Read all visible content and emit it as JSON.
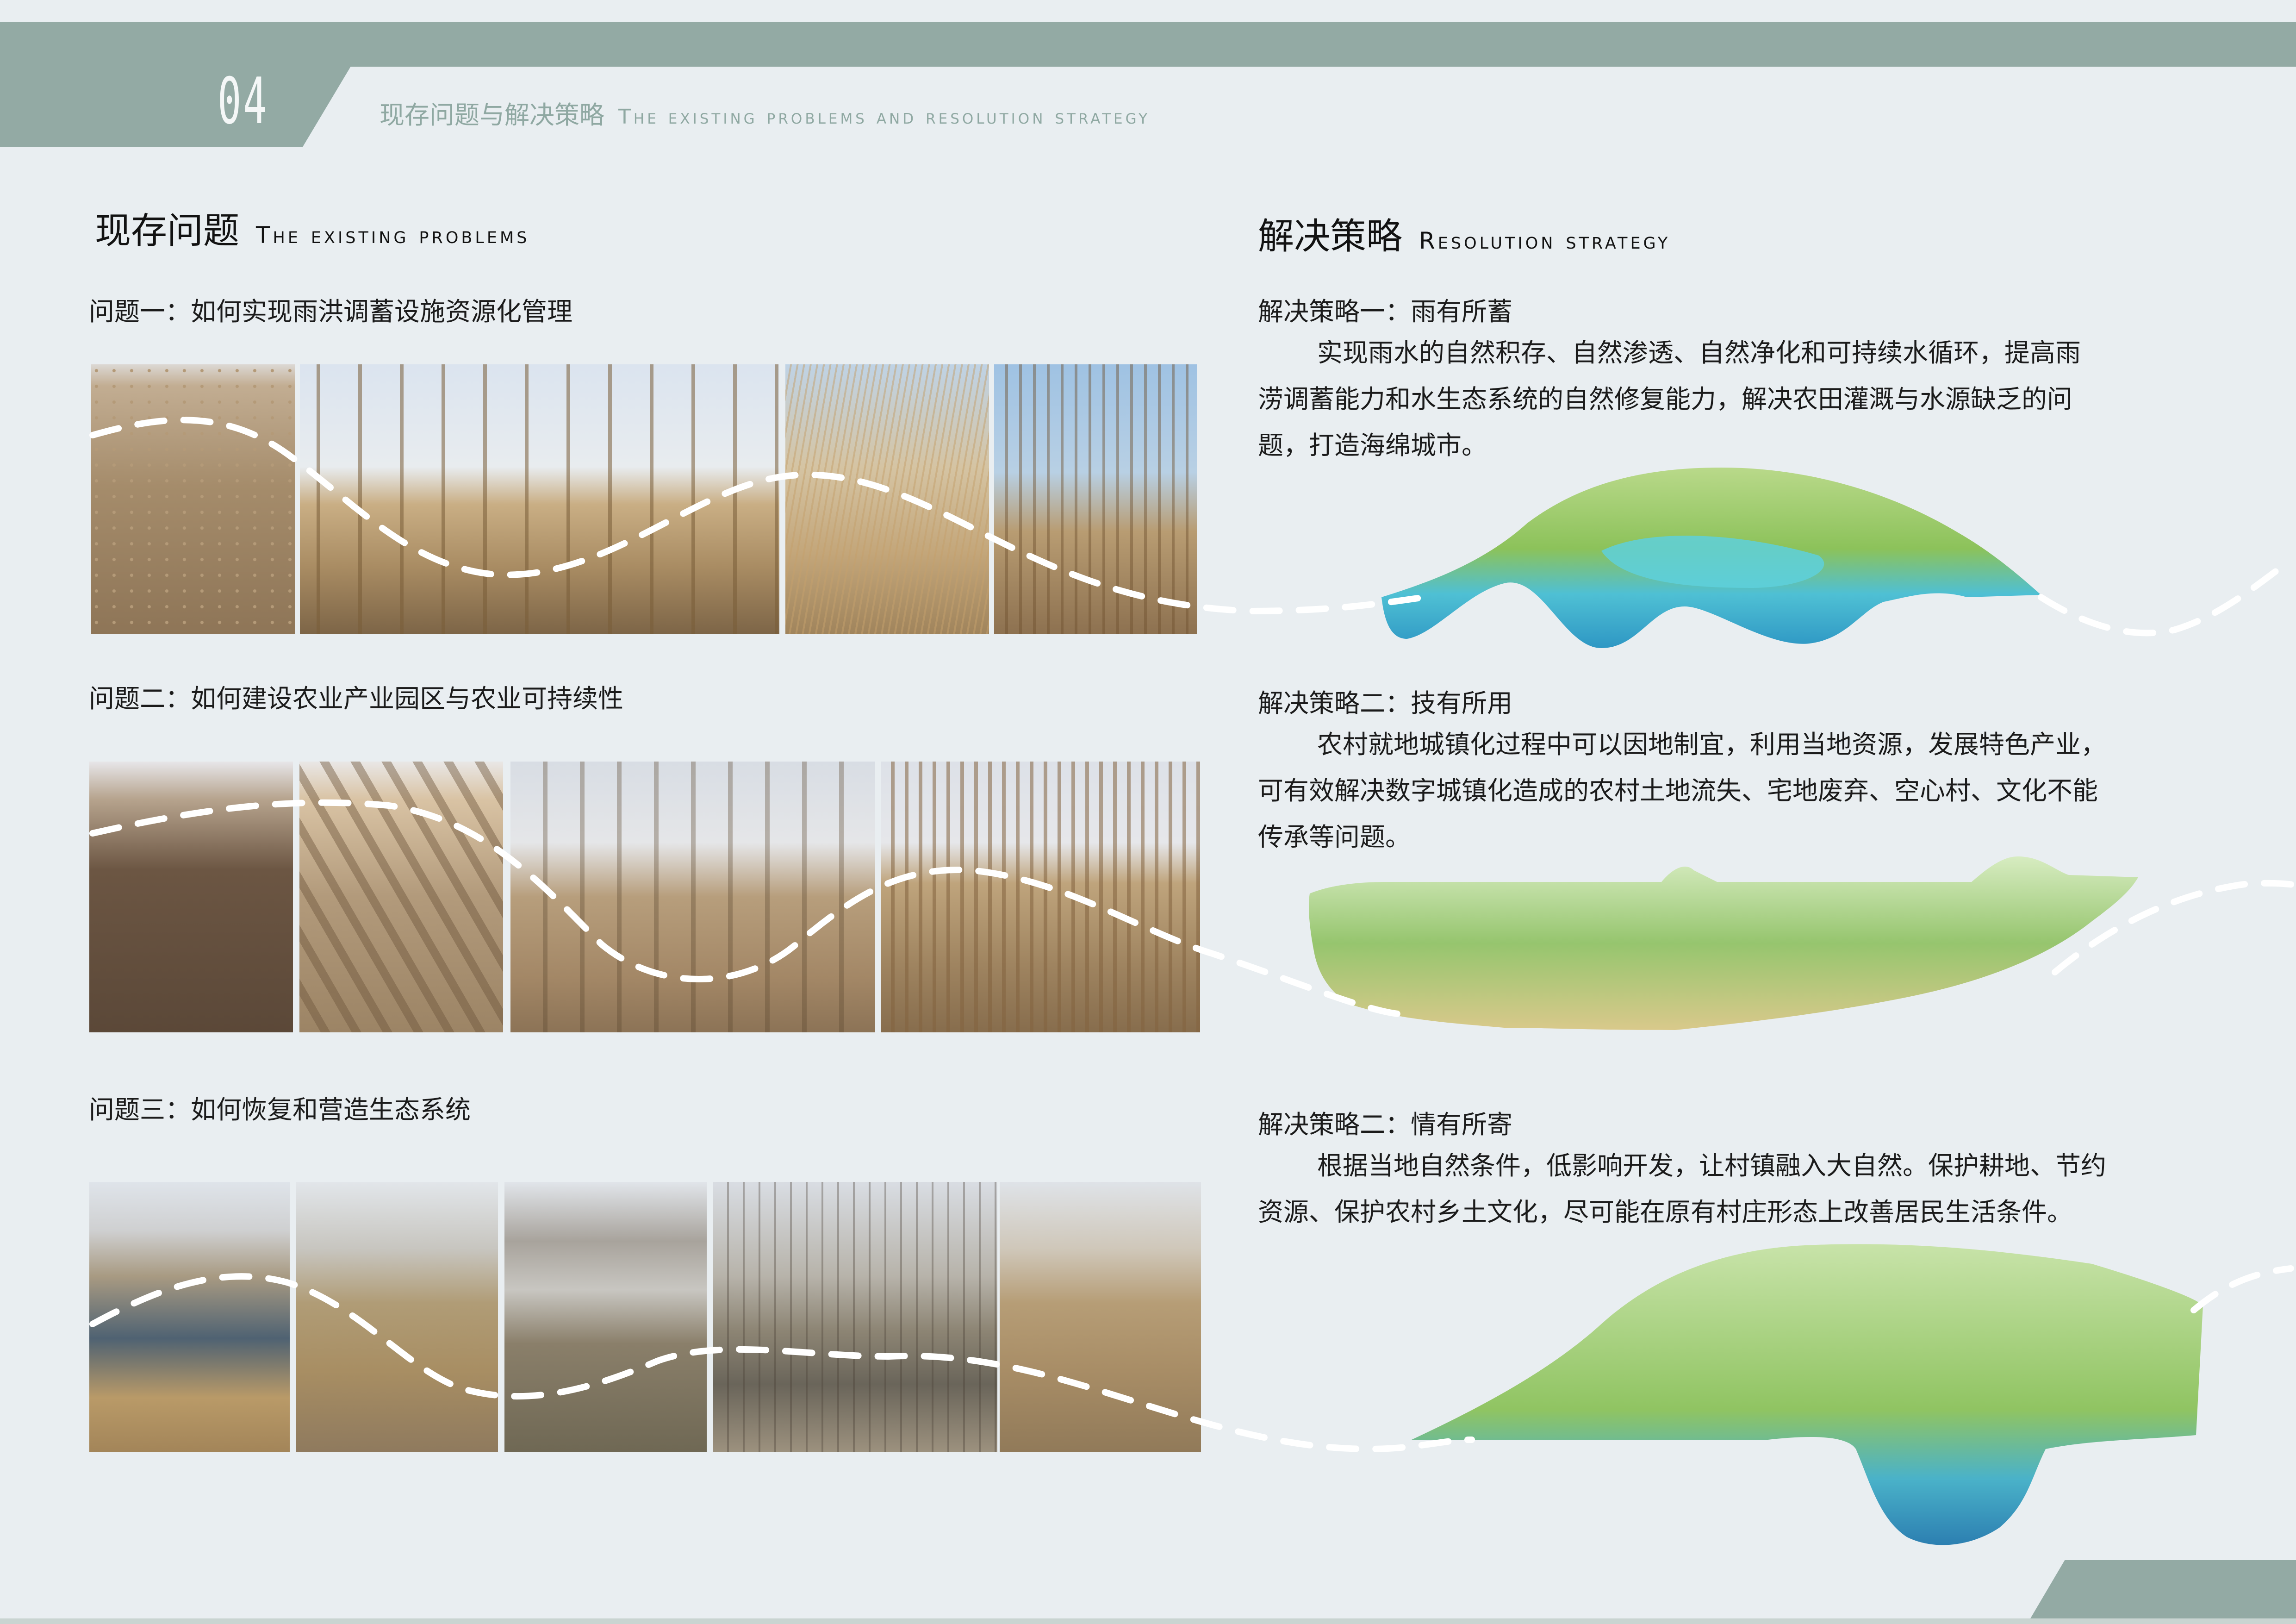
{
  "header": {
    "number": "04",
    "title_cn": "现存问题与解决策略",
    "title_en": "The existing problems and resolution strategy"
  },
  "left": {
    "title_cn": "现存问题",
    "title_en": "The existing problems",
    "problems": [
      {
        "label": "问题一：如何实现雨洪调蓄设施资源化管理"
      },
      {
        "label": "问题二：如何建设农业产业园区与农业可持续性"
      },
      {
        "label": "问题三：如何恢复和营造生态系统"
      }
    ]
  },
  "right": {
    "title_cn": "解决策略",
    "title_en": "Resolution strategy",
    "strategies": [
      {
        "label": "解决策略一：雨有所蓄",
        "lines": [
          "实现雨水的自然积存、自然渗透、自然净化和可持续水循环，提高雨",
          "涝调蓄能力和水生态系统的自然修复能力，解决农田灌溉与水源缺乏的问",
          "题，打造海绵城市。"
        ]
      },
      {
        "label": "解决策略二：技有所用",
        "lines": [
          "农村就地城镇化过程中可以因地制宜，利用当地资源，发展特色产业，",
          "可有效解决数字城镇化造成的农村土地流失、宅地废弃、空心村、文化不能",
          "传承等问题。"
        ]
      },
      {
        "label": "解决策略二：情有所寄",
        "lines": [
          "根据当地自然条件，低影响开发，让村镇融入大自然。保护耕地、节约",
          "资源、保护农村乡土文化，尽可能在原有村庄形态上改善居民生活条件。"
        ]
      }
    ]
  },
  "colors": {
    "band": "#93aaa4",
    "background": "#e9eef1",
    "dash": "#ffffff"
  }
}
